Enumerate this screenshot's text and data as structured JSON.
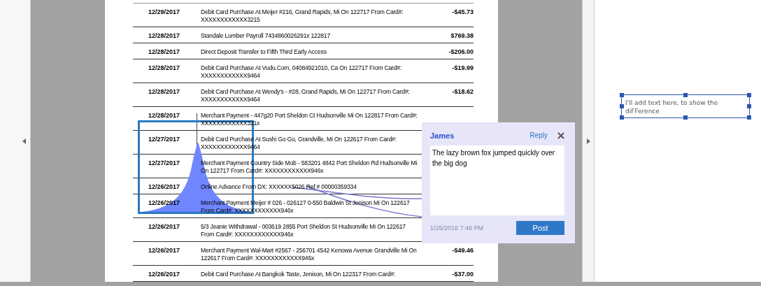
{
  "statement": {
    "rows": [
      {
        "date": "12/29/2017",
        "description": "Debit Card Purchase At Meijer #216, Grand Rapids, Mi On 122717 From Card#: XXXXXXXXXXXX3215",
        "amount": "-$45.73"
      },
      {
        "date": "12/28/2017",
        "description": "Standale Lumber Payroll 7434860026291x 122817",
        "amount": "$769.38"
      },
      {
        "date": "12/28/2017",
        "description": "Direct Deposit Transfer to Fifth Third Early Access",
        "amount": "-$206.00"
      },
      {
        "date": "12/28/2017",
        "description": "Debit Card Purchase At Vudu.Com, 04084921010, Ca On 122717 From Card#: XXXXXXXXXXXX9464",
        "amount": "-$19.99"
      },
      {
        "date": "12/28/2017",
        "description": "Debit Card Purchase At Wendy's - #28, Grand Rapids, Mi On 122717 From Card#: XXXXXXXXXXXX9464",
        "amount": "-$18.62"
      },
      {
        "date": "12/28/2017",
        "description": "Merchant Payment - 447g20 Port Sheldon Ct Hudsonville Mi On 122817 From Card#: XXXXXXXXXXXX321x"
      },
      {
        "date": "12/27/2017",
        "description": "Debit Card Purchase At Sushi Go Go, Grandville, Mi On 122617 From Card#: XXXXXXXXXXXX9464"
      },
      {
        "date": "12/27/2017",
        "description": "Merchant Payment Country Side Mob - 583201 4842 Port Sheldon Rd Hudsonville Mi On 122717 From Card#: XXXXXXXXXXXX946x"
      },
      {
        "date": "12/26/2017",
        "description": "Online Advance From DX: XXXXXX5026 Ref # 00000359334"
      },
      {
        "date": "12/26/2017",
        "description": "Merchant Payment Meijer # 026 - 026127 0-550 Baldwin St Jenison Mi On 122617 From Card#: XXXXXXXXXXXX946x"
      },
      {
        "date": "12/26/2017",
        "description": "5/3 Jeanie Withdrawal - 003619 2855 Port Sheldon St Hudsonville Mi On 122617 From Card#: XXXXXXXXXXXX946x"
      },
      {
        "date": "12/26/2017",
        "description": "Merchant Payment Wal-Mart #2567 - 256701 4542 Kenowa Avenue Grandville Mi On 122617 From Card#: XXXXXXXXXXXX946x",
        "amount": "-$49.46"
      },
      {
        "date": "12/26/2017",
        "description": "Debit Card Purchase At Bangkok Taste, Jenison, Mi On 122317 From Card#:",
        "amount": "-$37.00"
      }
    ]
  },
  "comment": {
    "author": "James",
    "reply": "Reply",
    "text": "The lazy brown fox jumped quickly over the big dog",
    "timestamp": "1/25/2018  7:46 PM",
    "post": "Post"
  },
  "text_box": {
    "text": "I'll add text here, to show  the diFFerence"
  }
}
